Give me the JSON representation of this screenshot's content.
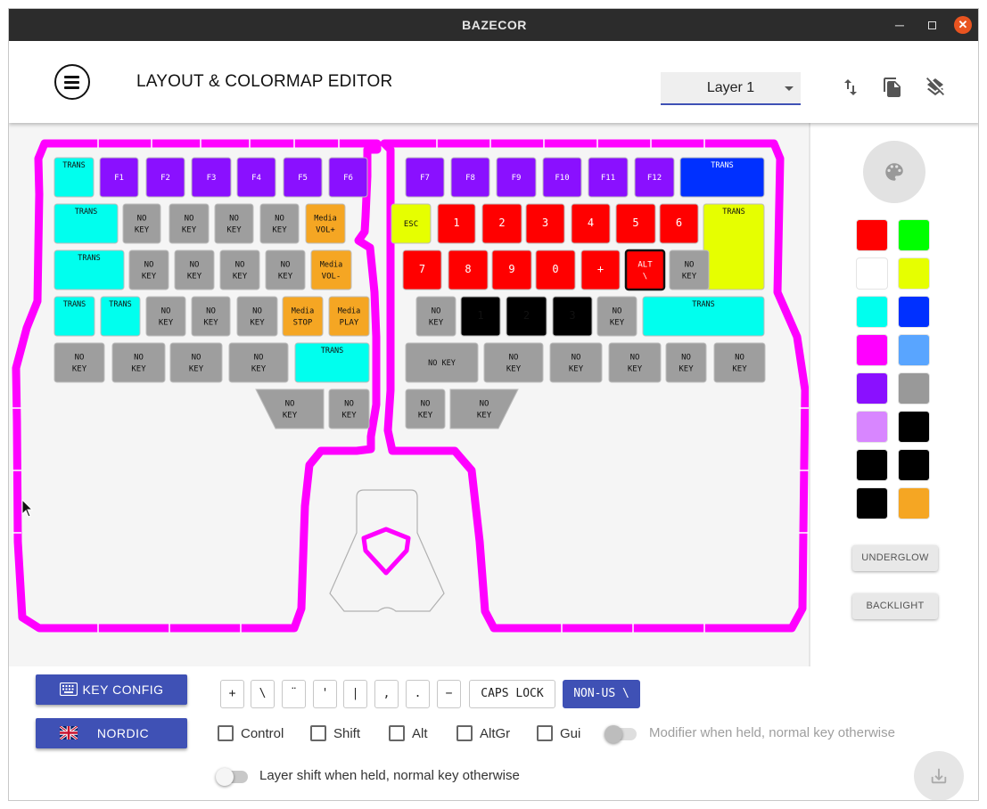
{
  "window": {
    "title": "BAZECOR"
  },
  "header": {
    "title": "LAYOUT & COLORMAP EDITOR",
    "layer_selected": "Layer 1"
  },
  "colors": {
    "accent": "#3f51b5",
    "led_strip": "#ff00ff",
    "trans": "#00ffee",
    "no_key": "#9e9e9e",
    "f_keys": "#8a10ff",
    "media": "#f5a623",
    "numbers": "#ff0000",
    "yellow": "#e6ff00",
    "blue": "#0030ff"
  },
  "left_keys": [
    [
      "TRANS",
      "F1",
      "F2",
      "F3",
      "F4",
      "F5",
      "F6"
    ],
    [
      "TRANS",
      "NO\nKEY",
      "NO\nKEY",
      "NO\nKEY",
      "NO\nKEY",
      "Media\nVOL+"
    ],
    [
      "TRANS",
      "NO\nKEY",
      "NO\nKEY",
      "NO\nKEY",
      "NO\nKEY",
      "Media\nVOL-"
    ],
    [
      "TRANS",
      "TRANS",
      "NO\nKEY",
      "NO\nKEY",
      "NO\nKEY",
      "Media\nSTOP",
      "Media\nPLAY"
    ],
    [
      "NO\nKEY",
      "NO\nKEY",
      "NO\nKEY",
      "NO\nKEY",
      "TRANS"
    ],
    [
      "NO\nKEY",
      "NO\nKEY"
    ]
  ],
  "right_keys": [
    [
      "F7",
      "F8",
      "F9",
      "F10",
      "F11",
      "F12",
      "TRANS"
    ],
    [
      "ESC",
      "1",
      "2",
      "3",
      "4",
      "5",
      "6",
      "TRANS"
    ],
    [
      "7",
      "8",
      "9",
      "0",
      "+",
      "ALT\n\\",
      "NO\nKEY"
    ],
    [
      "NO\nKEY",
      "1",
      "2",
      "3",
      "NO\nKEY",
      "TRANS"
    ],
    [
      "NO KEY",
      "NO\nKEY",
      "NO\nKEY",
      "NO\nKEY",
      "NO\nKEY",
      "NO\nKEY"
    ],
    [
      "NO\nKEY",
      "NO\nKEY"
    ]
  ],
  "sidebar": {
    "palette": [
      "#ff0000",
      "#00ff00",
      "#ffffff",
      "#e6ff00",
      "#00ffee",
      "#0030ff",
      "#ff00ff",
      "#59a5ff",
      "#8a10ff",
      "#999999",
      "#d886ff",
      "#000000",
      "#000000",
      "#000000",
      "#000000",
      "#f5a623"
    ],
    "underglow_label": "UNDERGLOW",
    "backlight_label": "BACKLIGHT"
  },
  "bottom": {
    "key_config_label": "KEY CONFIG",
    "language_label": "NORDIC",
    "keys": [
      "+",
      "\\",
      "¨",
      "'",
      "|",
      ",",
      ".",
      "−",
      "CAPS LOCK",
      "NON-US \\"
    ],
    "active_key": "NON-US \\",
    "modifiers": [
      "Control",
      "Shift",
      "Alt",
      "AltGr",
      "Gui"
    ],
    "modifier_toggle_label": "Modifier when held, normal key otherwise",
    "layer_toggle_label": "Layer shift when held, normal key otherwise"
  }
}
